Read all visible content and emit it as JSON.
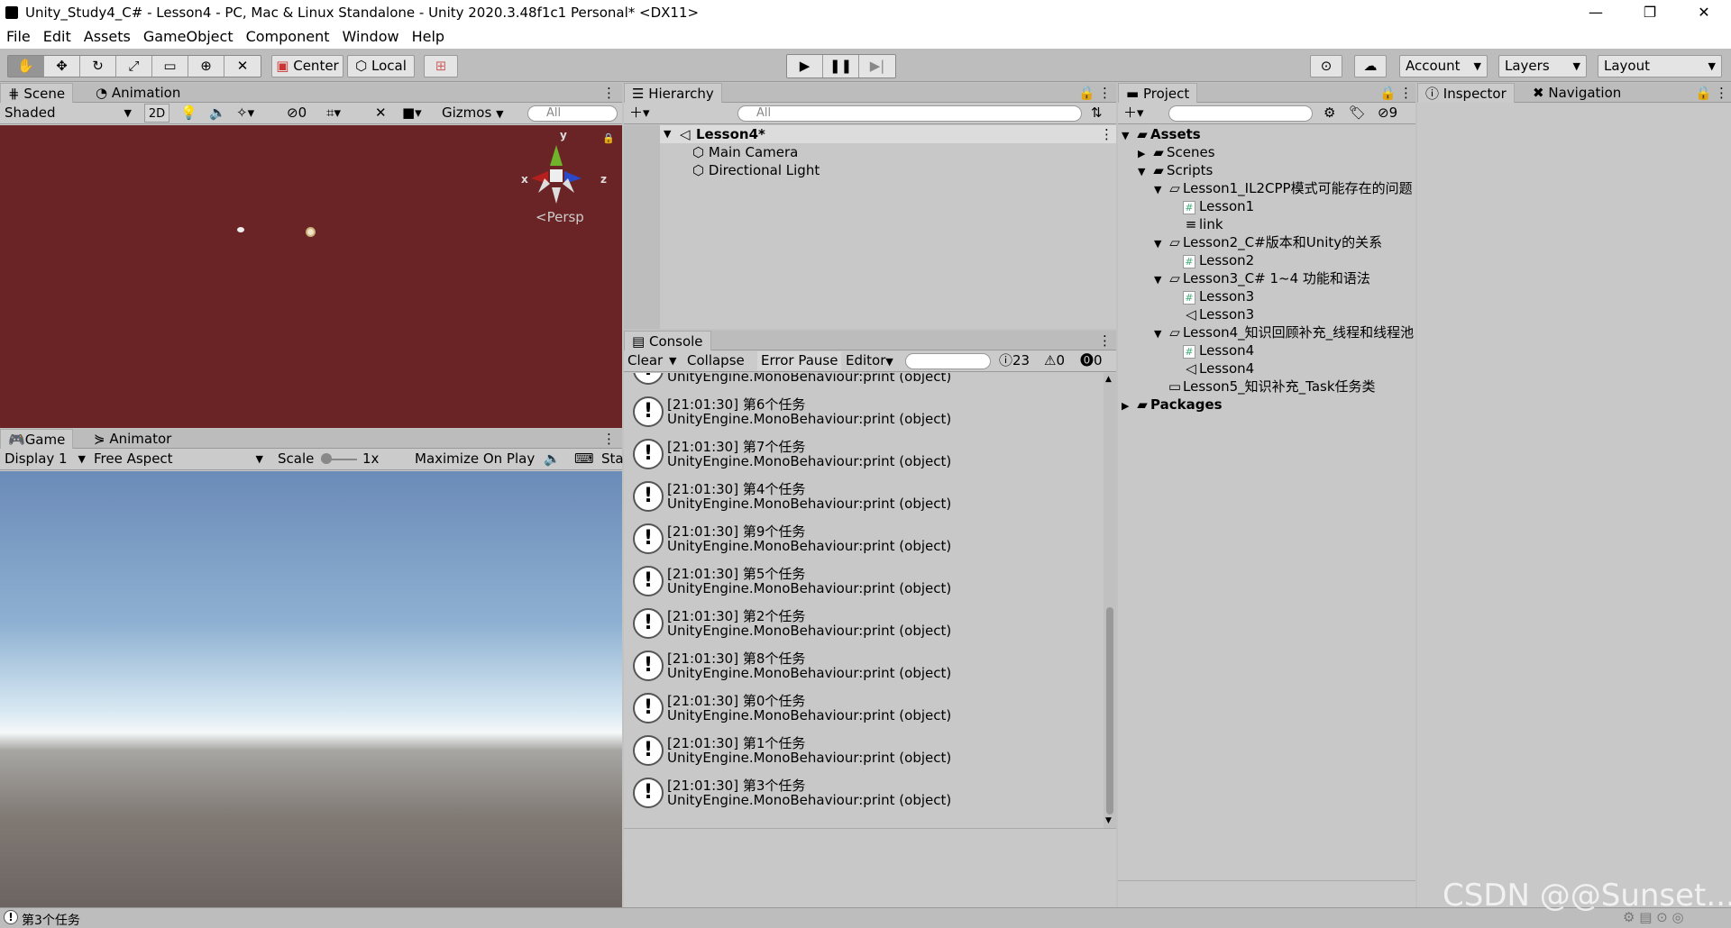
{
  "window": {
    "title": "Unity_Study4_C# - Lesson4 - PC, Mac & Linux Standalone - Unity 2020.3.48f1c1 Personal* <DX11>",
    "controls": [
      "—",
      "❐",
      "✕"
    ]
  },
  "menu": [
    "File",
    "Edit",
    "Assets",
    "GameObject",
    "Component",
    "Window",
    "Help"
  ],
  "toolbar": {
    "center_label": "Center",
    "local_label": "Local",
    "account_label": "Account",
    "layers_label": "Layers",
    "layout_label": "Layout"
  },
  "scene": {
    "tab_scene": "Scene",
    "tab_animation": "Animation",
    "shading": "Shaded",
    "mode_2d": "2D",
    "hidden_count": "0",
    "gizmos": "Gizmos",
    "search_placeholder": "All",
    "persp_label": "Persp",
    "axis_x": "x",
    "axis_y": "y",
    "axis_z": "z",
    "bg_color": "#6b2426"
  },
  "game": {
    "tab_game": "Game",
    "tab_animator": "Animator",
    "display": "Display 1",
    "aspect": "Free Aspect",
    "scale_label": "Scale",
    "scale_value": "1x",
    "maximize": "Maximize On Play",
    "stats": "Sta"
  },
  "hierarchy": {
    "tab": "Hierarchy",
    "search_placeholder": "All",
    "scene_name": "Lesson4*",
    "items": [
      "Main Camera",
      "Directional Light"
    ]
  },
  "console": {
    "tab": "Console",
    "clear": "Clear",
    "collapse": "Collapse",
    "error_pause": "Error Pause",
    "editor": "Editor",
    "log_count": "23",
    "warn_count": "0",
    "error_count": "0",
    "rows": [
      {
        "time": "[21:01:30] 第6个任务",
        "detail": "UnityEngine.MonoBehaviour:print (object)"
      },
      {
        "time": "[21:01:30] 第7个任务",
        "detail": "UnityEngine.MonoBehaviour:print (object)"
      },
      {
        "time": "[21:01:30] 第4个任务",
        "detail": "UnityEngine.MonoBehaviour:print (object)"
      },
      {
        "time": "[21:01:30] 第9个任务",
        "detail": "UnityEngine.MonoBehaviour:print (object)"
      },
      {
        "time": "[21:01:30] 第5个任务",
        "detail": "UnityEngine.MonoBehaviour:print (object)"
      },
      {
        "time": "[21:01:30] 第2个任务",
        "detail": "UnityEngine.MonoBehaviour:print (object)"
      },
      {
        "time": "[21:01:30] 第8个任务",
        "detail": "UnityEngine.MonoBehaviour:print (object)"
      },
      {
        "time": "[21:01:30] 第0个任务",
        "detail": "UnityEngine.MonoBehaviour:print (object)"
      },
      {
        "time": "[21:01:30] 第1个任务",
        "detail": "UnityEngine.MonoBehaviour:print (object)"
      },
      {
        "time": "[21:01:30] 第3个任务",
        "detail": "UnityEngine.MonoBehaviour:print (object)"
      }
    ],
    "partial_top_detail": "UnityEngine.MonoBehaviour:print (object)"
  },
  "project": {
    "tab": "Project",
    "hidden_count": "9",
    "tree": [
      {
        "label": "Assets",
        "depth": 0,
        "icon": "folder",
        "arrow": "down",
        "bold": true
      },
      {
        "label": "Scenes",
        "depth": 1,
        "icon": "folder",
        "arrow": "right"
      },
      {
        "label": "Scripts",
        "depth": 1,
        "icon": "folder",
        "arrow": "down"
      },
      {
        "label": "Lesson1_IL2CPP模式可能存在的问题",
        "depth": 2,
        "icon": "folder-open",
        "arrow": "down"
      },
      {
        "label": "Lesson1",
        "depth": 3,
        "icon": "script"
      },
      {
        "label": "link",
        "depth": 3,
        "icon": "text"
      },
      {
        "label": "Lesson2_C#版本和Unity的关系",
        "depth": 2,
        "icon": "folder-open",
        "arrow": "down"
      },
      {
        "label": "Lesson2",
        "depth": 3,
        "icon": "script"
      },
      {
        "label": "Lesson3_C# 1~4 功能和语法",
        "depth": 2,
        "icon": "folder-open",
        "arrow": "down"
      },
      {
        "label": "Lesson3",
        "depth": 3,
        "icon": "script"
      },
      {
        "label": "Lesson3",
        "depth": 3,
        "icon": "scene"
      },
      {
        "label": "Lesson4_知识回顾补充_线程和线程池",
        "depth": 2,
        "icon": "folder-open",
        "arrow": "down"
      },
      {
        "label": "Lesson4",
        "depth": 3,
        "icon": "script"
      },
      {
        "label": "Lesson4",
        "depth": 3,
        "icon": "scene"
      },
      {
        "label": "Lesson5_知识补充_Task任务类",
        "depth": 2,
        "icon": "folder-empty"
      },
      {
        "label": "Packages",
        "depth": 0,
        "icon": "folder",
        "arrow": "right",
        "bold": true
      }
    ]
  },
  "inspector": {
    "tab_inspector": "Inspector",
    "tab_navigation": "Navigation"
  },
  "status": {
    "message": "第3个任务"
  },
  "watermark": "CSDN @@Sunset..."
}
